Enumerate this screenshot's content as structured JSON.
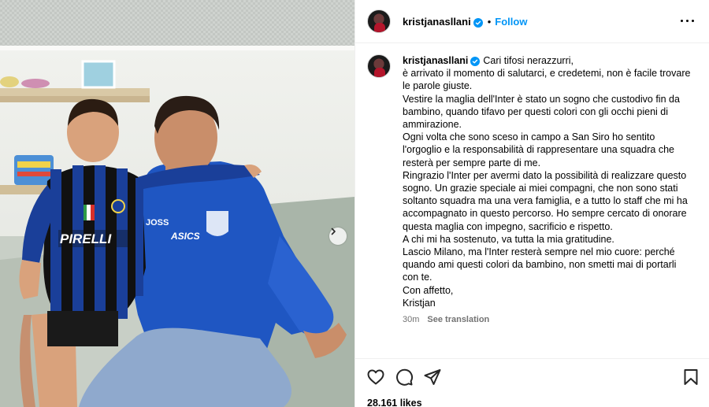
{
  "post": {
    "username": "kristjanasllani",
    "follow_label": "Follow",
    "separator": "•",
    "more_icon": "more-horizontal-icon",
    "verified_icon": "verified-badge-icon"
  },
  "photo": {
    "jersey_kid_text": "PIRELLI",
    "jersey_adult_text": "ASICS",
    "jersey_adult_sponsor": "JOSS",
    "carousel_icon": "chevron-right-icon",
    "colors": {
      "inter_blue": "#1a3f99",
      "inter_black": "#111111",
      "empoli_blue": "#1f56c2",
      "background": "#e9ebe6"
    }
  },
  "caption": {
    "username": "kristjanasllani",
    "lines": [
      "Cari tifosi nerazzurri,",
      "è arrivato il momento di salutarci, e credetemi, non è facile trovare le parole giuste.",
      "Vestire la maglia dell'Inter è stato un sogno che custodivo fin da bambino, quando tifavo per questi colori con gli occhi pieni di ammirazione.",
      "Ogni volta che sono sceso in campo a San Siro ho sentito l'orgoglio e la responsabilità di rappresentare una squadra che resterà per sempre parte di me.",
      "Ringrazio l'Inter per avermi dato la possibilità di realizzare questo sogno. Un grazie speciale ai miei compagni, che non sono stati soltanto squadra ma una vera famiglia, e a tutto lo staff che mi ha accompagnato in questo percorso. Ho sempre cercato di onorare questa maglia con impegno, sacrificio e rispetto.",
      "A chi mi ha sostenuto, va tutta la mia gratitudine.",
      "Lascio Milano, ma l'Inter resterà sempre nel mio cuore: perché quando ami questi colori da bambino, non smetti mai di portarli con te.",
      "Con affetto,",
      "Kristjan"
    ],
    "time_ago": "30m",
    "see_translation": "See translation"
  },
  "actions": {
    "like_icon": "heart-icon",
    "comment_icon": "comment-icon",
    "share_icon": "share-icon",
    "save_icon": "bookmark-icon",
    "likes_count": "28.161",
    "likes_label": "likes"
  }
}
